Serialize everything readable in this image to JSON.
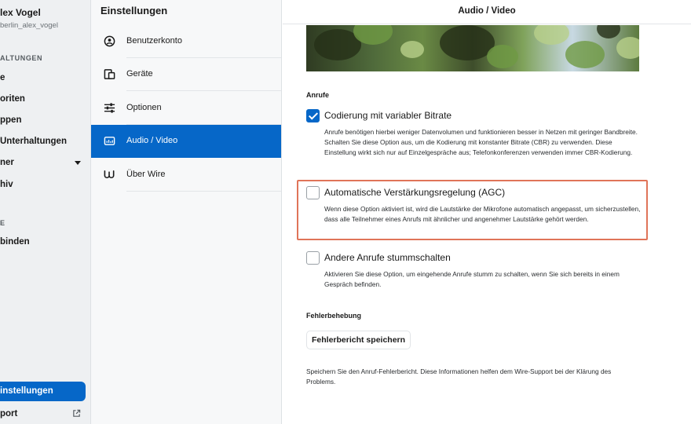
{
  "left_sidebar": {
    "user_name": "lex Vogel",
    "user_handle": "berlin_alex_vogel",
    "section_conversations": "ALTUNGEN",
    "items": [
      {
        "label": "e"
      },
      {
        "label": "oriten"
      },
      {
        "label": "ppen"
      },
      {
        "label": "Unterhaltungen"
      },
      {
        "label": "ner"
      },
      {
        "label": "hiv"
      }
    ],
    "section_other": "E",
    "connect_label": "binden",
    "settings_label": "instellungen",
    "support_label": "port",
    "icons": {
      "folders_caret": "chevron-down-icon",
      "support": "external-link-icon"
    }
  },
  "settings_panel": {
    "title": "Einstellungen",
    "items": [
      {
        "label": "Benutzerkonto",
        "icon": "user-circle-icon",
        "active": false
      },
      {
        "label": "Geräte",
        "icon": "devices-icon",
        "active": false
      },
      {
        "label": "Optionen",
        "icon": "sliders-icon",
        "active": false
      },
      {
        "label": "Audio / Video",
        "icon": "audio-video-icon",
        "active": true
      },
      {
        "label": "Über Wire",
        "icon": "wire-logo-icon",
        "active": false
      }
    ]
  },
  "main": {
    "title": "Audio / Video",
    "calls_heading": "Anrufe",
    "options": [
      {
        "label": "Codierung mit variabler Bitrate",
        "checked": true,
        "description": "Anrufe benötigen hierbei weniger Datenvolumen und funktionieren besser in Netzen mit geringer Bandbreite. Schalten Sie diese Option aus, um die Kodierung mit konstanter Bitrate (CBR) zu verwenden. Diese Einstellung wirkt sich nur auf Einzelgespräche aus; Telefonkonferenzen verwenden immer CBR-Kodierung."
      },
      {
        "label": "Automatische Verstärkungsregelung (AGC)",
        "checked": false,
        "description": "Wenn diese Option aktiviert ist, wird die Lautstärke der Mikrofone automatisch angepasst, um sicherzustellen, dass alle Teilnehmer eines Anrufs mit ähnlicher und angenehmer Lautstärke gehört werden."
      },
      {
        "label": "Andere Anrufe stummschalten",
        "checked": false,
        "description": "Aktivieren Sie diese Option, um eingehende Anrufe stumm zu schalten, wenn Sie sich bereits in einem Gespräch befinden."
      }
    ],
    "troubleshooting_heading": "Fehlerbehebung",
    "save_report_button": "Fehlerbericht speichern",
    "save_report_description": "Speichern Sie den Anruf-Fehlerbericht. Diese Informationen helfen dem Wire-Support bei der Klärung des Problems.",
    "colors": {
      "accent": "#0667c8",
      "highlight_border": "#e07459"
    }
  }
}
